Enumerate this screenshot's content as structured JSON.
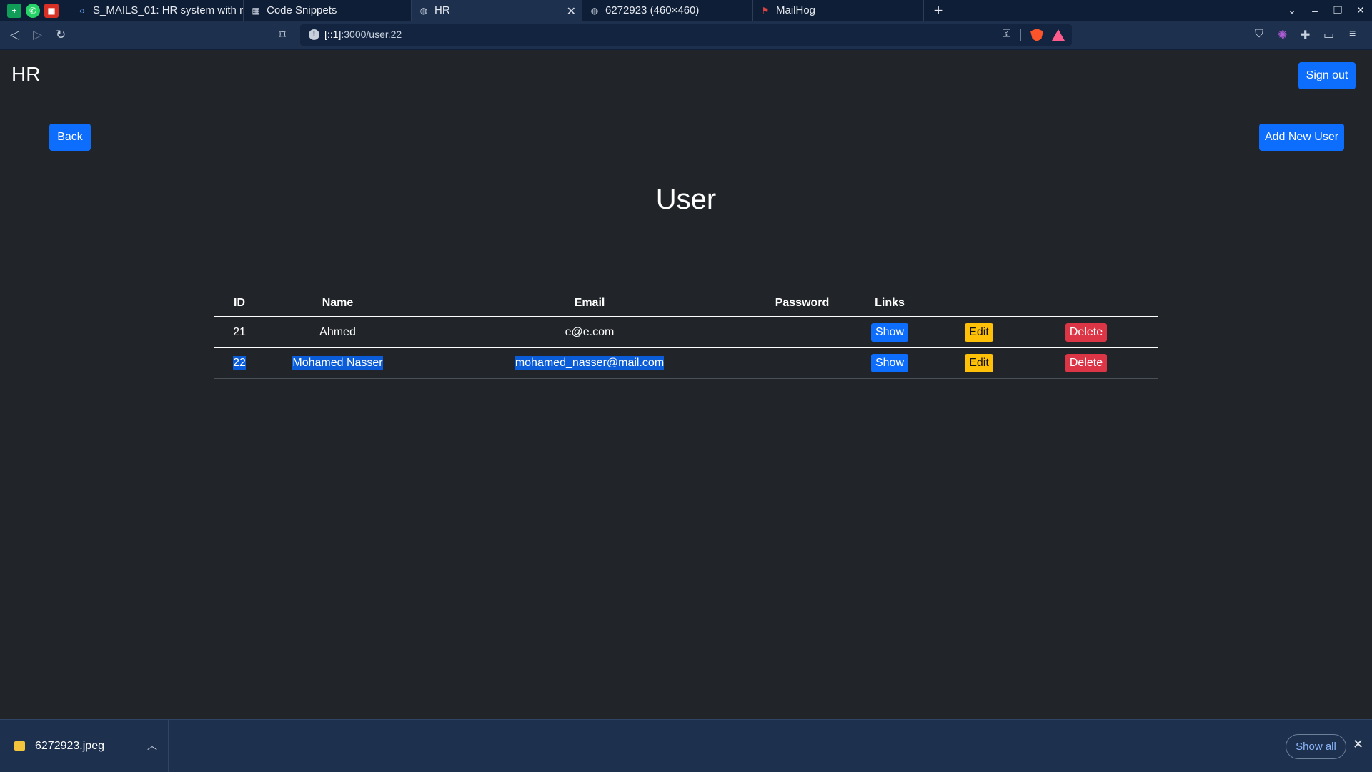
{
  "browser": {
    "pinned_tabs": [
      {
        "icon": "sheets-icon",
        "color": "#0f9d58",
        "glyph": "+"
      },
      {
        "icon": "whatsapp-icon",
        "color": "#25d366",
        "glyph": "◯"
      },
      {
        "icon": "notion-icon",
        "color": "#d93025",
        "glyph": "N"
      }
    ],
    "tabs": [
      {
        "title": "S_MAILS_01: HR system with m",
        "icon": "code-icon"
      },
      {
        "title": "Code Snippets",
        "icon": "snippets-icon"
      },
      {
        "title": "HR",
        "icon": "globe-icon",
        "active": true
      },
      {
        "title": "6272923 (460×460)",
        "icon": "globe-icon"
      },
      {
        "title": "MailHog",
        "icon": "mailhog-icon"
      }
    ],
    "address": {
      "host": "[::1]",
      "path": ":3000/user.22"
    }
  },
  "page": {
    "brand": "HR",
    "sign_out_label": "Sign out",
    "back_label": "Back",
    "add_user_label": "Add New User",
    "title": "User"
  },
  "table": {
    "headers": [
      "ID",
      "Name",
      "Email",
      "Password",
      "Links"
    ],
    "rows": [
      {
        "id": "21",
        "name": "Ahmed",
        "email": "e@e.com",
        "password": "",
        "selected": false
      },
      {
        "id": "22",
        "name": "Mohamed Nasser",
        "email": "mohamed_nasser@mail.com",
        "password": "",
        "selected": true
      }
    ],
    "actions": {
      "show": "Show",
      "edit": "Edit",
      "delete": "Delete"
    }
  },
  "downloads": {
    "file_name": "6272923.jpeg",
    "show_all_label": "Show all"
  },
  "colors": {
    "page_bg": "#212529",
    "primary": "#0d6efd",
    "warning": "#ffc107",
    "danger": "#dc3545",
    "chrome": "#1d314f"
  }
}
